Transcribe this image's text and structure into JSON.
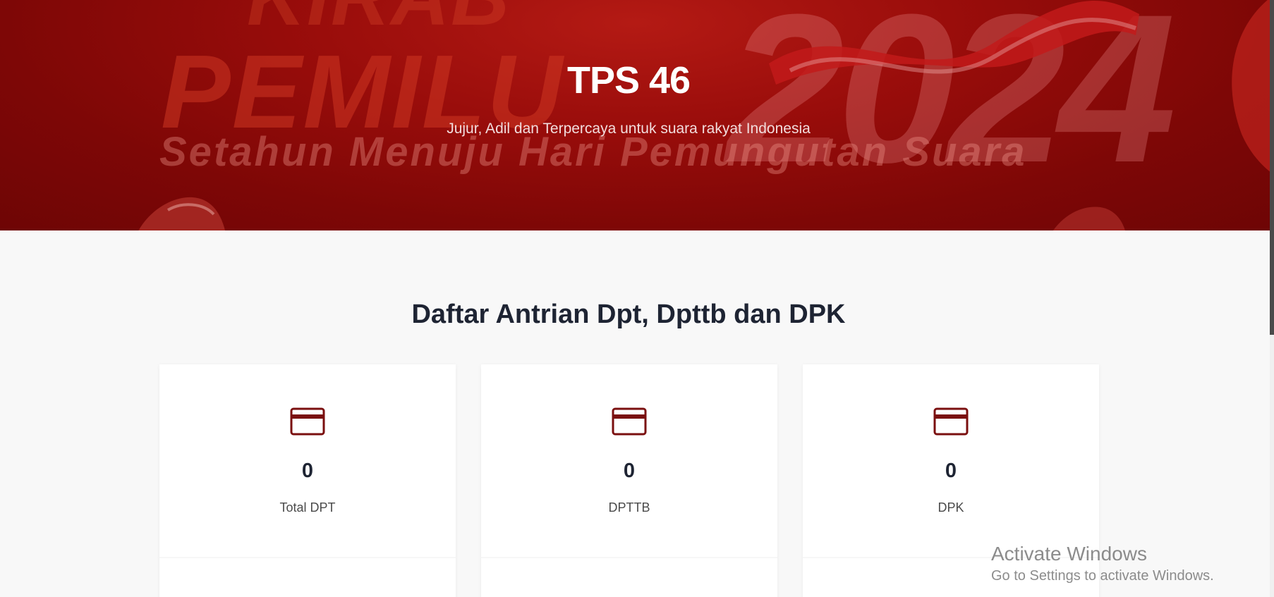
{
  "hero": {
    "banner_text_top": "KIRAB",
    "banner_text_main": "PEMILU",
    "banner_year": "2024",
    "banner_slogan": "Setahun Menuju Hari Pemungutan Suara",
    "title": "TPS 46",
    "subtitle": "Jujur, Adil dan Terpercaya untuk suara rakyat Indonesia"
  },
  "section": {
    "title": "Daftar Antrian Dpt, Dpttb dan DPK"
  },
  "cards": [
    {
      "icon": "credit-card-icon",
      "value": "0",
      "label": "Total DPT"
    },
    {
      "icon": "credit-card-icon",
      "value": "0",
      "label": "DPTTB"
    },
    {
      "icon": "credit-card-icon",
      "value": "0",
      "label": "DPK"
    }
  ],
  "watermark": {
    "title": "Activate Windows",
    "subtitle": "Go to Settings to activate Windows."
  },
  "colors": {
    "hero_red": "#9a0d0b",
    "accent": "#7a0f0f",
    "heading": "#1e2433",
    "page_bg": "#f8f8f8"
  }
}
